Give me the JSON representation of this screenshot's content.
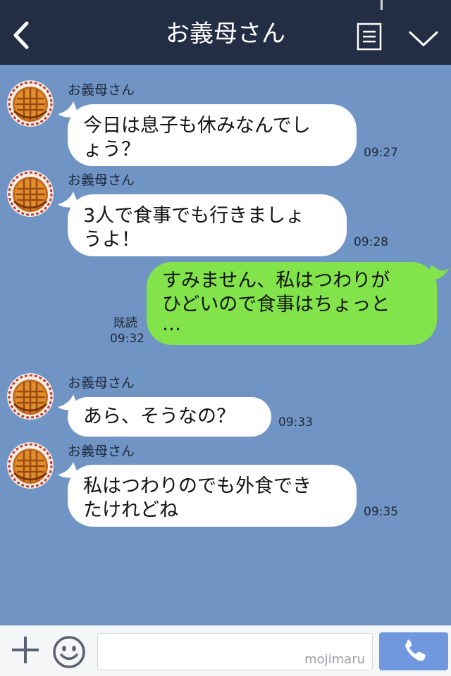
{
  "header": {
    "title": "お義母さん"
  },
  "messages": [
    {
      "sender": "お義母さん",
      "line1": "今日は息子も休みなんでし",
      "line2": "ょう？",
      "time": "09:27"
    },
    {
      "sender": "お義母さん",
      "line1": "3人で食事でも行きましょ",
      "line2": "うよ！",
      "time": "09:28"
    },
    {
      "line1": "すみません、私はつわりが",
      "line2": "ひどいので食事はちょっと",
      "line3": "…",
      "read": "既読",
      "time": "09:32"
    },
    {
      "sender": "お義母さん",
      "line1": "あら、そうなの？",
      "time": "09:33"
    },
    {
      "sender": "お義母さん",
      "line1": "私はつわりのでも外食でき",
      "line2": "たけれどね",
      "time": "09:35"
    }
  ],
  "footer": {
    "watermark": "mojimaru"
  },
  "colors": {
    "header": "#232d43",
    "background": "#7094c4",
    "outgoing_bubble": "#82e34b",
    "incoming_bubble": "#ffffff",
    "call_button": "#6f98df"
  },
  "icons": {
    "back": "chevron-left-icon",
    "menu": "list-icon",
    "collapse": "chevron-down-icon",
    "add": "plus-icon",
    "emoji": "smiley-icon",
    "call": "phone-icon",
    "avatar": "pie-avatar"
  }
}
